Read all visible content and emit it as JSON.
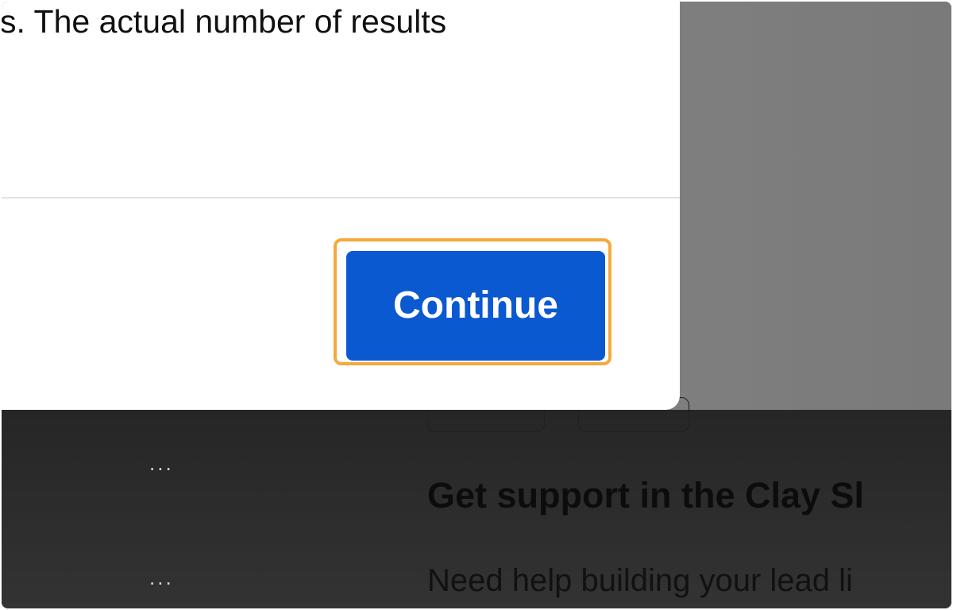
{
  "modal": {
    "body_text": "s. The actual number of results",
    "continue_label": "Continue"
  },
  "background": {
    "ellipsis": "...",
    "support_heading": "Get support in the Clay Sl",
    "support_body": "Need help building your lead li"
  },
  "colors": {
    "primary_button": "#0b59d0",
    "focus_highlight": "#f5a93b"
  }
}
